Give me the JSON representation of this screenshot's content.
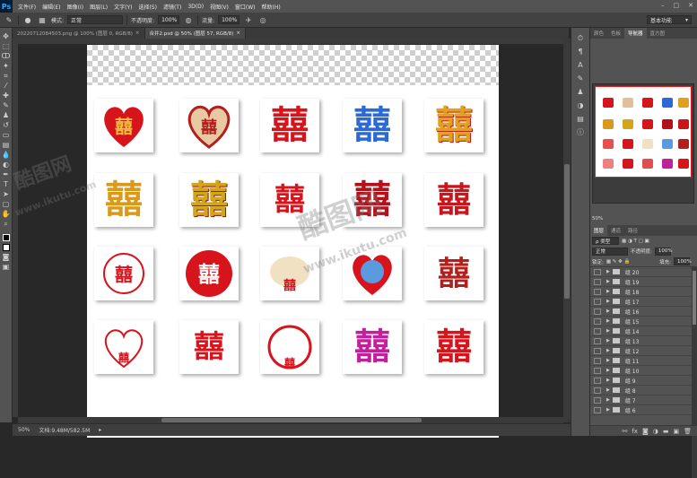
{
  "app": {
    "logo": "Ps"
  },
  "menu": [
    "文件(F)",
    "编辑(E)",
    "图像(I)",
    "图层(L)",
    "文字(Y)",
    "选择(S)",
    "滤镜(T)",
    "3D(D)",
    "视图(V)",
    "窗口(W)",
    "帮助(H)"
  ],
  "options": {
    "mode_label": "模式:",
    "mode_value": "正常",
    "opacity_label": "不透明度:",
    "opacity_value": "100%",
    "flow_label": "流量:",
    "flow_value": "100%",
    "workspace": "基本功能"
  },
  "tabs": [
    {
      "label": "20220712084503.png @ 100% (图层 0, RGB/8)",
      "close": "×"
    },
    {
      "label": "合并2.psd @ 50% (图层 57, RGB/8)",
      "close": "×"
    }
  ],
  "status": {
    "zoom": "50%",
    "doc": "文档:9.48M/582.5M"
  },
  "panels": {
    "top_tabs": [
      "颜色",
      "色板",
      "导航器",
      "直方图"
    ],
    "active_top": "导航器",
    "nav_zoom": "50%",
    "layer_tabs": [
      "图层",
      "通道",
      "路径"
    ],
    "kind_label": "ρ 类型",
    "blend_mode": "正常",
    "opacity_label": "不透明度:",
    "opacity_value": "100%",
    "lock_label": "锁定:",
    "fill_label": "填充:",
    "fill_value": "100%",
    "layers": [
      "组 20",
      "组 19",
      "组 18",
      "组 17",
      "组 16",
      "组 15",
      "组 14",
      "组 13",
      "组 12",
      "组 11",
      "组 10",
      "组 9",
      "组 8",
      "组 7",
      "组 6"
    ]
  },
  "watermark": {
    "brand": "酷图网",
    "url": "www.ikutu.com"
  },
  "colors": {
    "red": "#d7141c",
    "gold": "#e0a020",
    "blue": "#2a6ad6",
    "magenta": "#c0209a"
  }
}
